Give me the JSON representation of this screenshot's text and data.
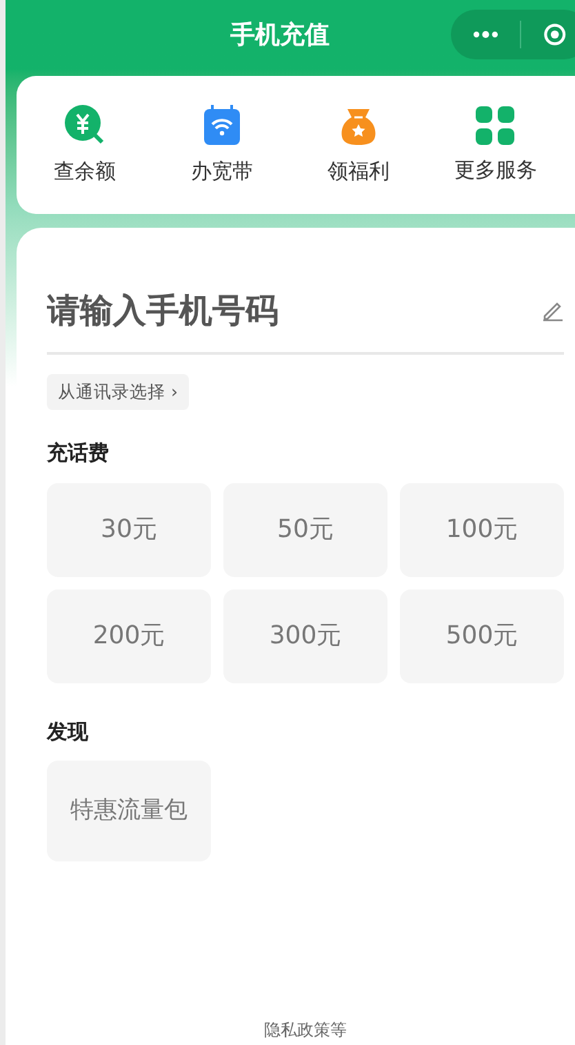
{
  "header": {
    "title": "手机充值"
  },
  "services": [
    {
      "kind": "balance",
      "label": "查余额"
    },
    {
      "kind": "broadband",
      "label": "办宽带"
    },
    {
      "kind": "gift",
      "label": "领福利"
    },
    {
      "kind": "more",
      "label": "更多服务"
    }
  ],
  "phone_input": {
    "placeholder": "请输入手机号码",
    "contacts_button": "从通讯录选择 ›"
  },
  "recharge": {
    "title": "充话费",
    "options": [
      "30元",
      "50元",
      "100元",
      "200元",
      "300元",
      "500元"
    ]
  },
  "discover": {
    "title": "发现",
    "items": [
      "特惠流量包"
    ]
  },
  "footer": {
    "link": "隐私政策等"
  }
}
